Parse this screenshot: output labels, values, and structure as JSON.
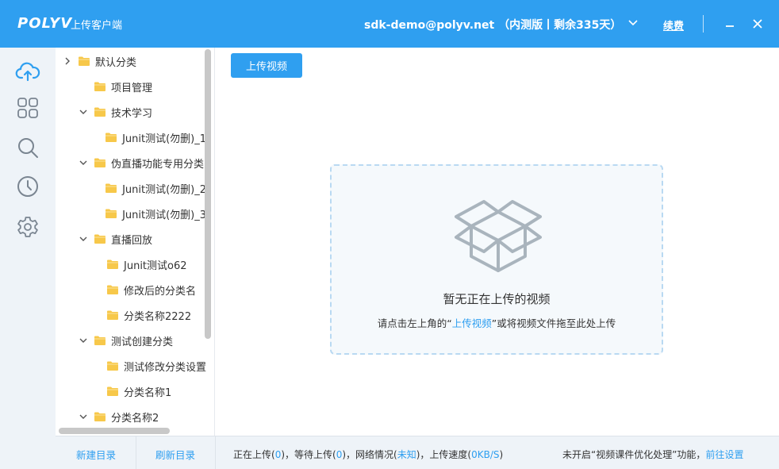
{
  "titlebar": {
    "logo": "POLYV",
    "app_name": "上传客户端",
    "account": "sdk-demo@polyv.net （内测版丨剩余335天）",
    "renew": "续费"
  },
  "rail": {
    "items": [
      {
        "icon": "cloud-upload-icon",
        "active": true
      },
      {
        "icon": "grid-icon",
        "active": false
      },
      {
        "icon": "search-icon",
        "active": false
      },
      {
        "icon": "clock-icon",
        "active": false
      },
      {
        "icon": "gear-icon",
        "active": false
      }
    ]
  },
  "tree": {
    "items": [
      {
        "label": "默认分类",
        "level": 0,
        "arrow": "right"
      },
      {
        "label": "项目管理",
        "level": 1,
        "arrow": "none"
      },
      {
        "label": "技术学习",
        "level": 1,
        "arrow": "down"
      },
      {
        "label": "Junit测试(勿删)_1",
        "level": 2,
        "arrow": "none"
      },
      {
        "label": "伪直播功能专用分类",
        "level": 1,
        "arrow": "down"
      },
      {
        "label": "Junit测试(勿删)_2",
        "level": 2,
        "arrow": "none"
      },
      {
        "label": "Junit测试(勿删)_3",
        "level": 2,
        "arrow": "none"
      },
      {
        "label": "直播回放",
        "level": 1,
        "arrow": "down"
      },
      {
        "label": "Junit测试o62",
        "level": 2,
        "arrow": "none"
      },
      {
        "label": "修改后的分类名",
        "level": 2,
        "arrow": "none"
      },
      {
        "label": "分类名称2222",
        "level": 2,
        "arrow": "none"
      },
      {
        "label": "测试创建分类",
        "level": 1,
        "arrow": "down"
      },
      {
        "label": "测试修改分类设置",
        "level": 2,
        "arrow": "none"
      },
      {
        "label": "分类名称1",
        "level": 2,
        "arrow": "none"
      },
      {
        "label": "分类名称2",
        "level": 1,
        "arrow": "down"
      }
    ]
  },
  "main": {
    "upload_button": "上传视频",
    "empty_title": "暂无正在上传的视频",
    "hint_before": "请点击左上角的“",
    "hint_link": "上传视频",
    "hint_after": "”或将视频文件拖至此处上传"
  },
  "bottom": {
    "new_dir": "新建目录",
    "refresh_dir": "刷新目录",
    "uploading_label": "正在上传(",
    "uploading_count": "0",
    "waiting_label": ")，等待上传(",
    "waiting_count": "0",
    "network_label": ")，网络情况(",
    "network_value": "未知",
    "speed_label": ")，上传速度(",
    "speed_value": "0KB/S",
    "speed_close": ")",
    "notice_text": "未开启“视频课件优化处理”功能，",
    "notice_link": "前往设置"
  },
  "colors": {
    "accent": "#2f9ff0",
    "rail_bg": "#eef3f8",
    "folder": "#f7c84a"
  }
}
